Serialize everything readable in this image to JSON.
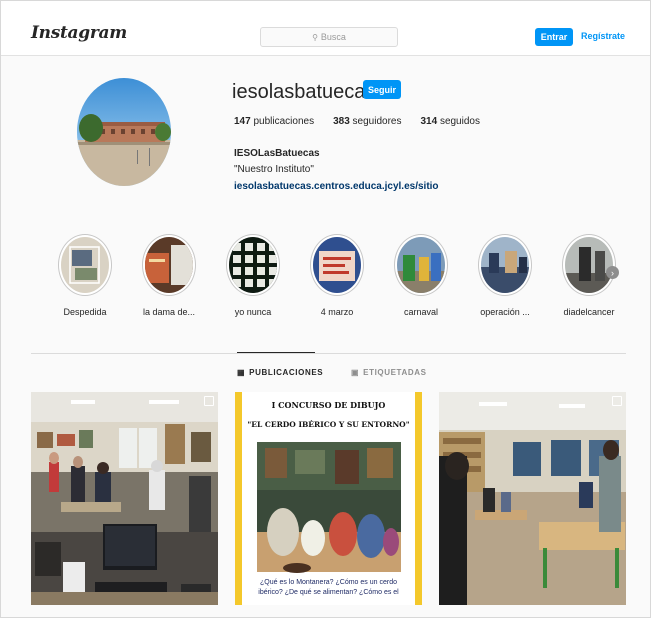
{
  "header": {
    "logo": "Instagram",
    "search_placeholder": "Busca",
    "login_label": "Entrar",
    "signup_label": "Regístrate"
  },
  "profile": {
    "username": "iesolasbatuecas",
    "follow_label": "Seguir",
    "posts_count": "147",
    "posts_label": "publicaciones",
    "followers_count": "383",
    "followers_label": "seguidores",
    "following_count": "314",
    "following_label": "seguidos",
    "full_name": "IESOLasBatuecas",
    "bio": "\"Nuestro Instituto\"",
    "website": "iesolasbatuecas.centros.educa.jcyl.es/sitio"
  },
  "highlights": [
    {
      "label": "Despedida"
    },
    {
      "label": "la dama de..."
    },
    {
      "label": "yo nunca"
    },
    {
      "label": "4 marzo"
    },
    {
      "label": "carnaval"
    },
    {
      "label": "operación ..."
    },
    {
      "label": "diadelcancer"
    }
  ],
  "tabs": [
    {
      "label": "PUBLICACIONES",
      "active": true
    },
    {
      "label": "ETIQUETADAS",
      "active": false
    }
  ],
  "poster": {
    "title_line1": "I CONCURSO DE DIBUJO",
    "title_line2": "\"EL CERDO IBÉRICO Y SU ENTORNO\"",
    "caption_line1": "¿Qué es lo Montanera? ¿Cómo es un cerdo",
    "caption_line2": "ibérico? ¿De qué se alimentan? ¿Cómo es el"
  },
  "colors": {
    "accent": "#0095f6",
    "link": "#00376b",
    "poster_border": "#f4c82b"
  }
}
